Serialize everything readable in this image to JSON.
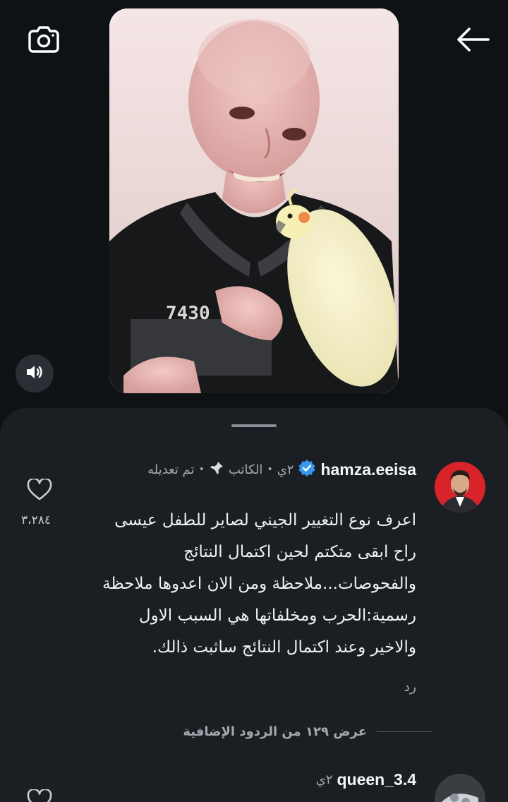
{
  "top_bar": {
    "camera_icon": "camera-icon",
    "back_icon": "arrow-left-icon",
    "sound_icon": "speaker-icon"
  },
  "media": {
    "shirt_text": "7430"
  },
  "comments": [
    {
      "username": "hamza.eeisa",
      "verified": true,
      "time": "٢ي",
      "author_label": "الكاتب",
      "edited_label": "تم تعديله",
      "text_lines": [
        "اعرف نوع التغيير الجيني لصاير للطفل عيسى",
        "راح ابقى متكتم لحين اكتمال النتائج",
        "والفحوصات...ملاحظة ومن الان اعدوها ملاحظة",
        "رسمية:الحرب ومخلفاتها هي السبب الاول",
        "والاخير وعند اكتمال النتائج ساثبت ذالك."
      ],
      "reply_label": "رد",
      "like_count": "٣،٢٨٤",
      "more_replies": "عرض ١٢٩ من الردود الإضافية"
    },
    {
      "username": "queen_3.4",
      "time": "٢ي"
    }
  ],
  "colors": {
    "background": "#0f1215",
    "sheet": "#1b1f23",
    "verified_badge": "#3897f0",
    "avatar_red": "#d8232a"
  }
}
